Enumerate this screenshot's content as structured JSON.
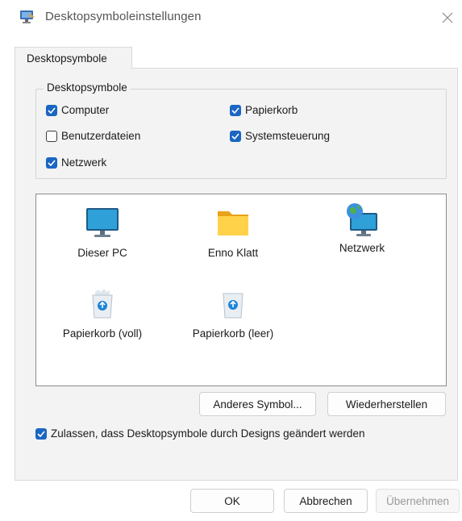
{
  "window": {
    "title": "Desktopsymboleinstellungen",
    "icon": "display-properties-icon",
    "close_icon": "close-icon"
  },
  "tabs": [
    {
      "label": "Desktopsymbole",
      "active": true
    }
  ],
  "group": {
    "legend": "Desktopsymbole",
    "checkboxes": [
      {
        "label": "Computer",
        "checked": true
      },
      {
        "label": "Papierkorb",
        "checked": true
      },
      {
        "label": "Benutzerdateien",
        "checked": false
      },
      {
        "label": "Systemsteuerung",
        "checked": true
      },
      {
        "label": "Netzwerk",
        "checked": true
      }
    ]
  },
  "icons": [
    {
      "label": "Dieser PC",
      "icon": "monitor-icon"
    },
    {
      "label": "Enno Klatt",
      "icon": "folder-icon"
    },
    {
      "label": "Netzwerk",
      "icon": "network-globe-icon"
    },
    {
      "label": "Papierkorb (voll)",
      "icon": "recycle-bin-full-icon"
    },
    {
      "label": "Papierkorb (leer)",
      "icon": "recycle-bin-empty-icon"
    }
  ],
  "buttons": {
    "change_icon": "Anderes Symbol...",
    "restore": "Wiederherstellen",
    "ok": "OK",
    "cancel": "Abbrechen",
    "apply": "Übernehmen"
  },
  "allow_themes": {
    "label": "Zulassen, dass Desktopsymbole durch Designs geändert werden",
    "checked": true
  },
  "colors": {
    "accent": "#1a66c2",
    "dialog_bg": "#f3f3f3"
  }
}
